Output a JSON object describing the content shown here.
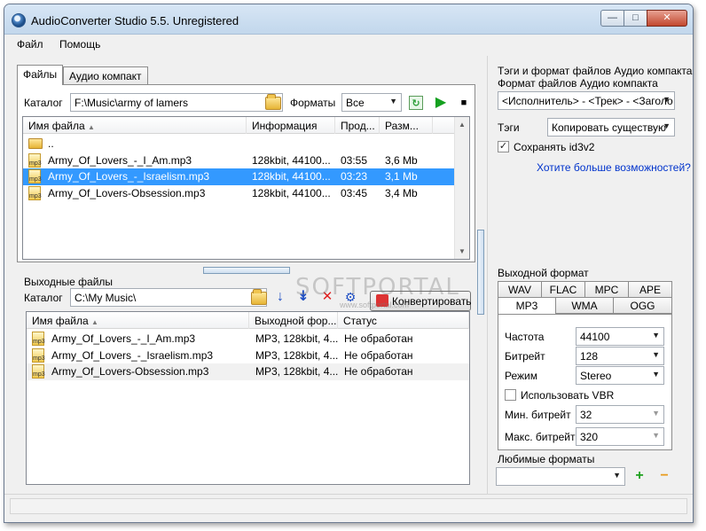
{
  "window": {
    "title": "AudioConverter Studio 5.5. Unregistered"
  },
  "menu": {
    "file": "Файл",
    "help": "Помощь"
  },
  "tabs": {
    "files": "Файлы",
    "audio_cd": "Аудио компакт"
  },
  "source": {
    "catalog_label": "Каталог",
    "catalog_path": "F:\\Music\\army of lamers",
    "formats_label": "Форматы",
    "formats_value": "Все",
    "columns": [
      "Имя файла",
      "Информация",
      "Прод...",
      "Разм..."
    ],
    "parent_dir": "..",
    "rows": [
      {
        "name": "Army_Of_Lovers_-_I_Am.mp3",
        "info": "128kbit, 44100...",
        "duration": "03:55",
        "size": "3,6 Mb"
      },
      {
        "name": "Army_Of_Lovers_-_Israelism.mp3",
        "info": "128kbit, 44100...",
        "duration": "03:23",
        "size": "3,1 Mb"
      },
      {
        "name": "Army_Of_Lovers-Obsession.mp3",
        "info": "128kbit, 44100...",
        "duration": "03:45",
        "size": "3,4 Mb"
      }
    ]
  },
  "output": {
    "title": "Выходные файлы",
    "catalog_label": "Каталог",
    "catalog_path": "C:\\My Music\\",
    "convert_label": "Конвертировать",
    "columns": [
      "Имя файла",
      "Выходной фор...",
      "Статус"
    ],
    "rows": [
      {
        "name": "Army_Of_Lovers_-_I_Am.mp3",
        "format": "MP3, 128kbit, 4...",
        "status": "Не обработан"
      },
      {
        "name": "Army_Of_Lovers_-_Israelism.mp3",
        "format": "MP3, 128kbit, 4...",
        "status": "Не обработан"
      },
      {
        "name": "Army_Of_Lovers-Obsession.mp3",
        "format": "MP3, 128kbit, 4...",
        "status": "Не обработан"
      }
    ]
  },
  "tags_panel": {
    "heading_line1": "Тэги и формат файлов Аудио компакта",
    "heading_line2": "Формат файлов Аудио компакта",
    "pattern_value": "<Исполнитель> - <Трек> - <Заголо",
    "tags_label": "Тэги",
    "tags_value": "Копировать существую",
    "keep_id3_label": "Сохранять id3v2",
    "more_link": "Хотите больше возможностей?"
  },
  "format_panel": {
    "title": "Выходной формат",
    "tabs_top": [
      "WAV",
      "FLAC",
      "MPC",
      "APE"
    ],
    "tabs_bottom": [
      "MP3",
      "WMA",
      "OGG"
    ],
    "freq_label": "Частота",
    "freq_value": "44100",
    "bitrate_label": "Битрейт",
    "bitrate_value": "128",
    "mode_label": "Режим",
    "mode_value": "Stereo",
    "vbr_label": "Использовать VBR",
    "min_bitrate_label": "Мин. битрейт",
    "min_bitrate_value": "32",
    "max_bitrate_label": "Макс. битрейт",
    "max_bitrate_value": "320",
    "favorites_label": "Любимые форматы"
  },
  "watermark": {
    "text": "SOFTPORTAL",
    "sub": "www.softportal.com"
  }
}
